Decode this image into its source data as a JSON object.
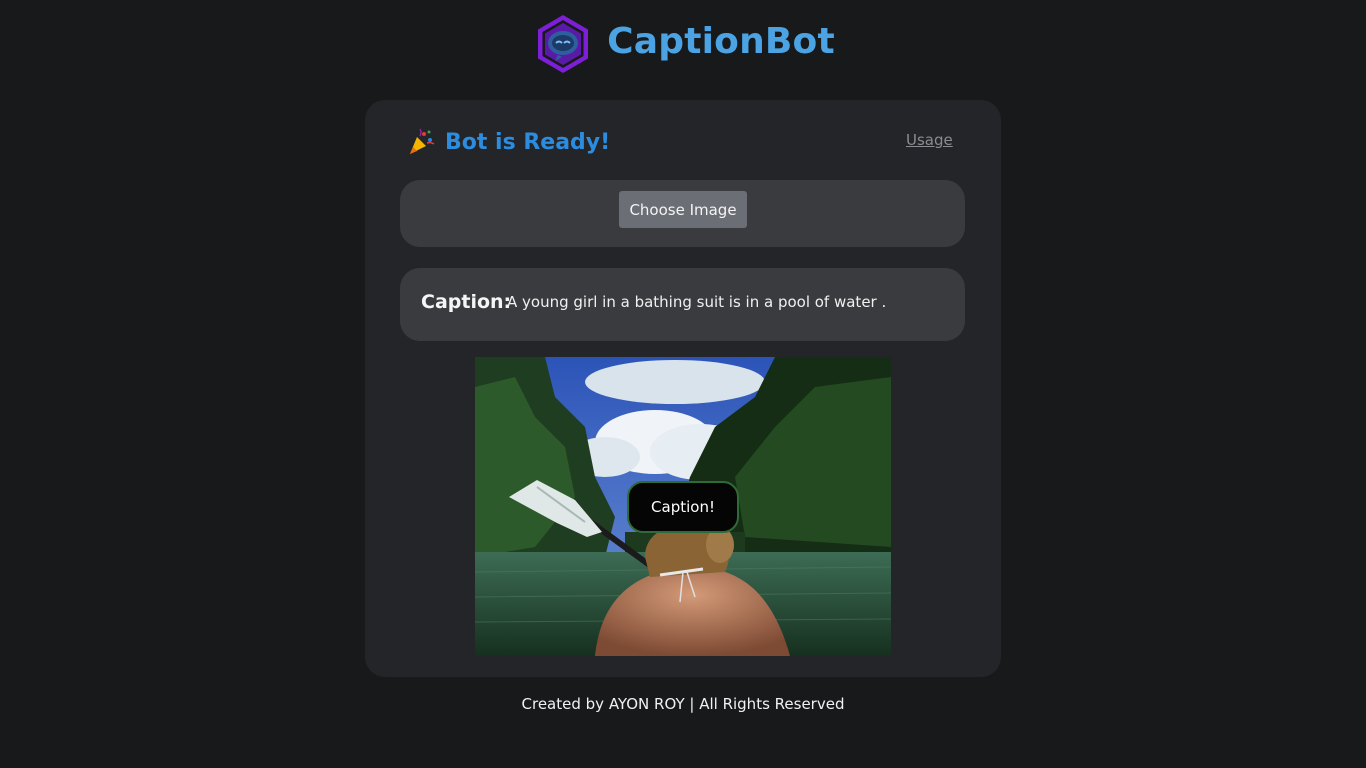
{
  "header": {
    "brand": "CaptionBot",
    "logo_icon": "robot-logo-icon",
    "brand_color": "#4ba3e3"
  },
  "card": {
    "status_icon": "party-popper-icon",
    "status_text": "Bot is Ready!",
    "status_color": "#2b8ce0",
    "usage_link": "Usage",
    "choose_button": "Choose Image",
    "caption_label": "Caption:",
    "caption_text": "A young girl in a bathing suit is in a pool of water .",
    "caption_button": "Caption!"
  },
  "footer": {
    "text": "Created by AYON ROY | All Rights Reserved"
  }
}
